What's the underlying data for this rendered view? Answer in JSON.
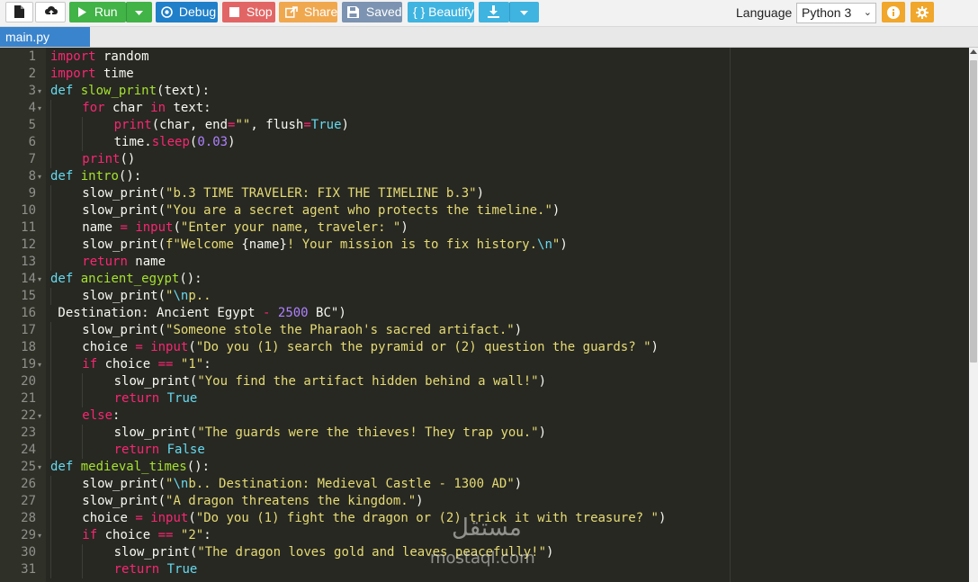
{
  "toolbar": {
    "run_label": "Run",
    "debug_label": "Debug",
    "stop_label": "Stop",
    "share_label": "Share",
    "saved_label": "Saved",
    "beautify_label": "{ } Beautify",
    "language_label": "Language",
    "language_value": "Python 3",
    "icons": [
      "new-file-icon",
      "upload-icon",
      "play-icon",
      "dropdown-caret-icon",
      "debug-icon",
      "stop-icon",
      "share-icon",
      "save-icon",
      "download-icon",
      "info-icon",
      "gear-icon"
    ]
  },
  "tab": {
    "label": "main.py"
  },
  "watermark": {
    "arabic": "مستقل",
    "latin": "mostaql.com"
  },
  "editor": {
    "lines": [
      {
        "n": "1",
        "fold": "",
        "indent": 0,
        "tokens": [
          [
            "k",
            "import"
          ],
          [
            "p",
            " random"
          ]
        ]
      },
      {
        "n": "2",
        "fold": "",
        "indent": 0,
        "tokens": [
          [
            "k",
            "import"
          ],
          [
            "p",
            " time"
          ]
        ]
      },
      {
        "n": "3",
        "fold": "▾",
        "indent": 0,
        "tokens": [
          [
            "b",
            "def"
          ],
          [
            "p",
            " "
          ],
          [
            "f",
            "slow_print"
          ],
          [
            "p",
            "(text):"
          ]
        ]
      },
      {
        "n": "4",
        "fold": "▾",
        "indent": 1,
        "tokens": [
          [
            "k",
            "for"
          ],
          [
            "p",
            " char "
          ],
          [
            "k",
            "in"
          ],
          [
            "p",
            " text:"
          ]
        ]
      },
      {
        "n": "5",
        "fold": "",
        "indent": 2,
        "tokens": [
          [
            "k",
            "print"
          ],
          [
            "p",
            "(char, end"
          ],
          [
            "k",
            "="
          ],
          [
            "s",
            "\"\""
          ],
          [
            "p",
            ", flush"
          ],
          [
            "k",
            "="
          ],
          [
            "b",
            "True"
          ],
          [
            "p",
            ")"
          ]
        ]
      },
      {
        "n": "6",
        "fold": "",
        "indent": 2,
        "tokens": [
          [
            "p",
            "time."
          ],
          [
            "k",
            "sleep"
          ],
          [
            "p",
            "("
          ],
          [
            "n",
            "0.03"
          ],
          [
            "p",
            ")"
          ]
        ]
      },
      {
        "n": "7",
        "fold": "",
        "indent": 1,
        "tokens": [
          [
            "k",
            "print"
          ],
          [
            "p",
            "()"
          ]
        ]
      },
      {
        "n": "8",
        "fold": "▾",
        "indent": 0,
        "tokens": [
          [
            "b",
            "def"
          ],
          [
            "p",
            " "
          ],
          [
            "f",
            "intro"
          ],
          [
            "p",
            "():"
          ]
        ]
      },
      {
        "n": "9",
        "fold": "",
        "indent": 1,
        "tokens": [
          [
            "p",
            "slow_print("
          ],
          [
            "s",
            "\"b.3 TIME TRAVELER: FIX THE TIMELINE b.3\""
          ],
          [
            "p",
            ")"
          ]
        ]
      },
      {
        "n": "10",
        "fold": "",
        "indent": 1,
        "tokens": [
          [
            "p",
            "slow_print("
          ],
          [
            "s",
            "\"You are a secret agent who protects the timeline.\""
          ],
          [
            "p",
            ")"
          ]
        ]
      },
      {
        "n": "11",
        "fold": "",
        "indent": 1,
        "tokens": [
          [
            "p",
            "name "
          ],
          [
            "k",
            "="
          ],
          [
            "p",
            " "
          ],
          [
            "k",
            "input"
          ],
          [
            "p",
            "("
          ],
          [
            "s",
            "\"Enter your name, traveler: \""
          ],
          [
            "p",
            ")"
          ]
        ]
      },
      {
        "n": "12",
        "fold": "",
        "indent": 1,
        "tokens": [
          [
            "p",
            "slow_print("
          ],
          [
            "s",
            "f\"Welcome "
          ],
          [
            "p",
            "{name}"
          ],
          [
            "s",
            "! Your mission is to fix history."
          ],
          [
            "b",
            "\\n"
          ],
          [
            "s",
            "\""
          ],
          [
            "p",
            ")"
          ]
        ]
      },
      {
        "n": "13",
        "fold": "",
        "indent": 1,
        "tokens": [
          [
            "k",
            "return"
          ],
          [
            "p",
            " name"
          ]
        ]
      },
      {
        "n": "14",
        "fold": "▾",
        "indent": 0,
        "tokens": [
          [
            "b",
            "def"
          ],
          [
            "p",
            " "
          ],
          [
            "f",
            "ancient_egypt"
          ],
          [
            "p",
            "():"
          ]
        ]
      },
      {
        "n": "15",
        "fold": "",
        "indent": 1,
        "tokens": [
          [
            "p",
            "slow_print("
          ],
          [
            "s",
            "\""
          ],
          [
            "b",
            "\\n"
          ],
          [
            "s",
            "p.."
          ]
        ]
      },
      {
        "n": "16",
        "fold": "",
        "indent": -1,
        "tokens": [
          [
            "p",
            " Destination: Ancient Egypt "
          ],
          [
            "k",
            "-"
          ],
          [
            "p",
            " "
          ],
          [
            "n",
            "2500"
          ],
          [
            "p",
            " BC\")"
          ]
        ]
      },
      {
        "n": "17",
        "fold": "",
        "indent": 1,
        "tokens": [
          [
            "p",
            "slow_print("
          ],
          [
            "s",
            "\"Someone stole the Pharaoh's sacred artifact.\""
          ],
          [
            "p",
            ")"
          ]
        ]
      },
      {
        "n": "18",
        "fold": "",
        "indent": 1,
        "tokens": [
          [
            "p",
            "choice "
          ],
          [
            "k",
            "="
          ],
          [
            "p",
            " "
          ],
          [
            "k",
            "input"
          ],
          [
            "p",
            "("
          ],
          [
            "s",
            "\"Do you (1) search the pyramid or (2) question the guards? \""
          ],
          [
            "p",
            ")"
          ]
        ]
      },
      {
        "n": "19",
        "fold": "▾",
        "indent": 1,
        "tokens": [
          [
            "k",
            "if"
          ],
          [
            "p",
            " choice "
          ],
          [
            "k",
            "=="
          ],
          [
            "p",
            " "
          ],
          [
            "s",
            "\"1\""
          ],
          [
            "p",
            ":"
          ]
        ]
      },
      {
        "n": "20",
        "fold": "",
        "indent": 2,
        "tokens": [
          [
            "p",
            "slow_print("
          ],
          [
            "s",
            "\"You find the artifact hidden behind a wall!\""
          ],
          [
            "p",
            ")"
          ]
        ]
      },
      {
        "n": "21",
        "fold": "",
        "indent": 2,
        "tokens": [
          [
            "k",
            "return"
          ],
          [
            "p",
            " "
          ],
          [
            "b",
            "True"
          ]
        ]
      },
      {
        "n": "22",
        "fold": "▾",
        "indent": 1,
        "tokens": [
          [
            "k",
            "else"
          ],
          [
            "p",
            ":"
          ]
        ]
      },
      {
        "n": "23",
        "fold": "",
        "indent": 2,
        "tokens": [
          [
            "p",
            "slow_print("
          ],
          [
            "s",
            "\"The guards were the thieves! They trap you.\""
          ],
          [
            "p",
            ")"
          ]
        ]
      },
      {
        "n": "24",
        "fold": "",
        "indent": 2,
        "tokens": [
          [
            "k",
            "return"
          ],
          [
            "p",
            " "
          ],
          [
            "b",
            "False"
          ]
        ]
      },
      {
        "n": "25",
        "fold": "▾",
        "indent": 0,
        "tokens": [
          [
            "b",
            "def"
          ],
          [
            "p",
            " "
          ],
          [
            "f",
            "medieval_times"
          ],
          [
            "p",
            "():"
          ]
        ]
      },
      {
        "n": "26",
        "fold": "",
        "indent": 1,
        "tokens": [
          [
            "p",
            "slow_print("
          ],
          [
            "s",
            "\""
          ],
          [
            "b",
            "\\n"
          ],
          [
            "s",
            "b.. Destination: Medieval Castle - 1300 AD\""
          ],
          [
            "p",
            ")"
          ]
        ]
      },
      {
        "n": "27",
        "fold": "",
        "indent": 1,
        "tokens": [
          [
            "p",
            "slow_print("
          ],
          [
            "s",
            "\"A dragon threatens the kingdom.\""
          ],
          [
            "p",
            ")"
          ]
        ]
      },
      {
        "n": "28",
        "fold": "",
        "indent": 1,
        "tokens": [
          [
            "p",
            "choice "
          ],
          [
            "k",
            "="
          ],
          [
            "p",
            " "
          ],
          [
            "k",
            "input"
          ],
          [
            "p",
            "("
          ],
          [
            "s",
            "\"Do you (1) fight the dragon or (2) trick it with treasure? \""
          ],
          [
            "p",
            ")"
          ]
        ]
      },
      {
        "n": "29",
        "fold": "▾",
        "indent": 1,
        "tokens": [
          [
            "k",
            "if"
          ],
          [
            "p",
            " choice "
          ],
          [
            "k",
            "=="
          ],
          [
            "p",
            " "
          ],
          [
            "s",
            "\"2\""
          ],
          [
            "p",
            ":"
          ]
        ]
      },
      {
        "n": "30",
        "fold": "",
        "indent": 2,
        "tokens": [
          [
            "p",
            "slow_print("
          ],
          [
            "s",
            "\"The dragon loves gold and leaves peacefully!\""
          ],
          [
            "p",
            ")"
          ]
        ]
      },
      {
        "n": "31",
        "fold": "",
        "indent": 2,
        "tokens": [
          [
            "k",
            "return"
          ],
          [
            "p",
            " "
          ],
          [
            "b",
            "True"
          ]
        ]
      }
    ]
  }
}
